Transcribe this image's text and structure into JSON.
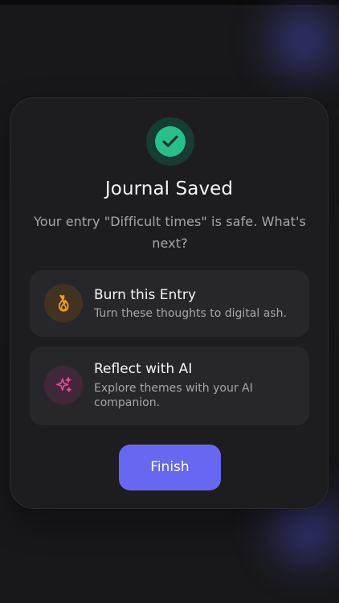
{
  "dialog": {
    "title": "Journal Saved",
    "subtitle": "Your entry \"Difficult times\" is safe. What's next?",
    "icon": "checkmark-icon"
  },
  "options": [
    {
      "title": "Burn this Entry",
      "description": "Turn these thoughts to digital ash.",
      "icon": "flame-icon",
      "color": "#f59e0b"
    },
    {
      "title": "Reflect with AI",
      "description": "Explore themes with your AI companion.",
      "icon": "sparkles-icon",
      "color": "#ec4899"
    }
  ],
  "actions": {
    "finish_label": "Finish"
  },
  "colors": {
    "background": "#18181b",
    "card": "#1d1d20",
    "option": "#27272b",
    "success": "#27c08a",
    "primary": "#6767f2"
  }
}
